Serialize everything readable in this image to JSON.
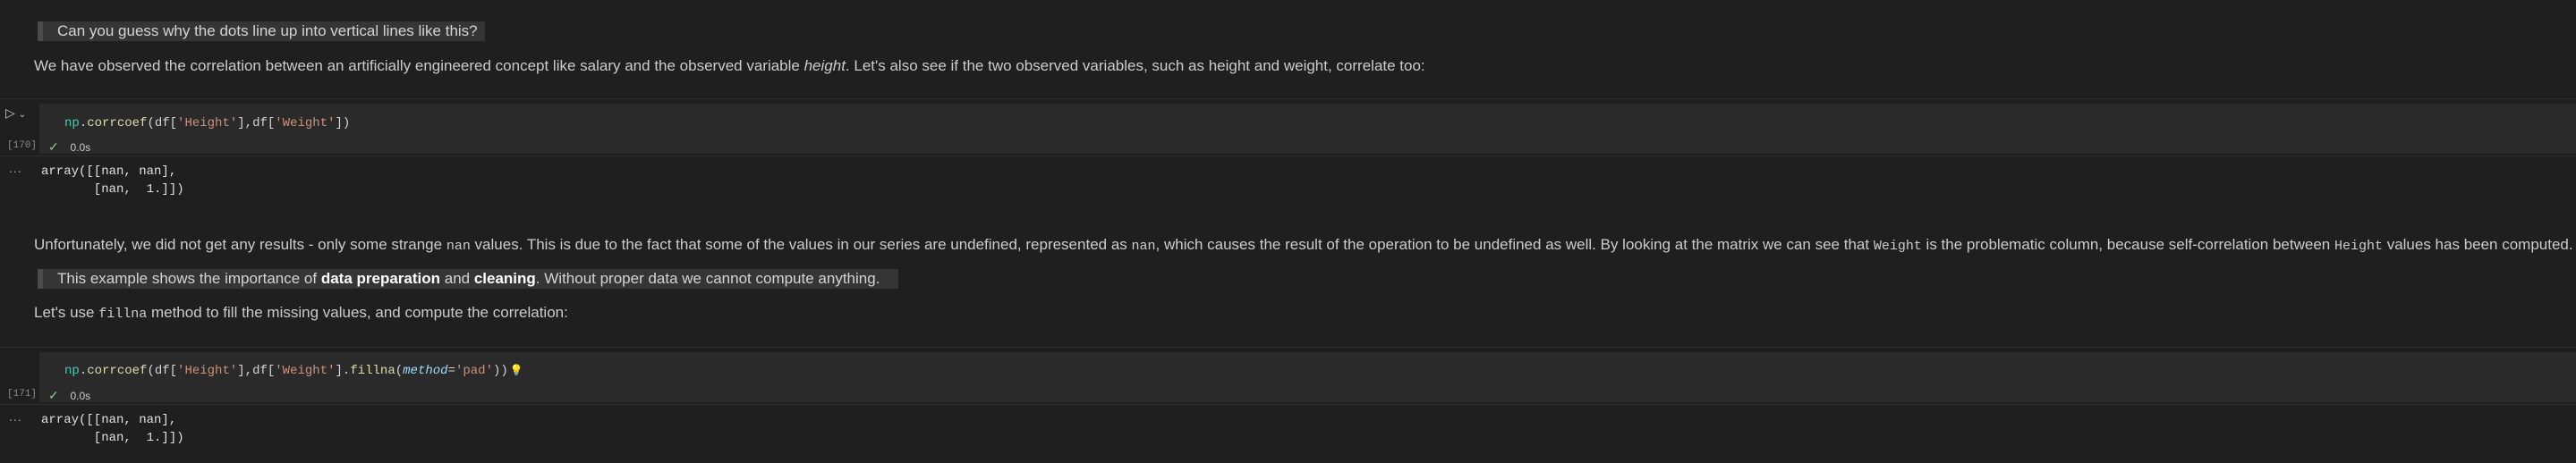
{
  "callout1": "Can you guess why the dots line up into vertical lines like this?",
  "para1": {
    "text_a": "We have observed the correlation between an artificially engineered concept like salary and the observed variable ",
    "em": "height",
    "text_b": ". Let's also see if the two observed variables, such as height and weight, correlate too:"
  },
  "cell1": {
    "prompt": "[170]",
    "code": {
      "np": "np",
      "dot": ".",
      "fn": "corrcoef",
      "open": "(df[",
      "s1": "'Height'",
      "mid": "],df[",
      "s2": "'Weight'",
      "close": "])"
    },
    "status_time": "0.0s",
    "output_dots": "...",
    "output": "array([[nan, nan],\n       [nan,  1.]])"
  },
  "para2": {
    "t1": "Unfortunately, we did not get any results - only some strange ",
    "c1": "nan",
    "t2": " values. This is due to the fact that some of the values in our series are undefined, represented as ",
    "c2": "nan",
    "t3": ", which causes the result of the operation to be undefined as well. By looking at the matrix we can see that ",
    "c3": "Weight",
    "t4": " is the problematic column, because self-correlation between ",
    "c4": "Height",
    "t5": " values has been computed."
  },
  "callout2": {
    "t1": "This example shows the importance of ",
    "b1": "data preparation",
    "t2": " and ",
    "b2": "cleaning",
    "t3": ". Without proper data we cannot compute anything."
  },
  "para3": {
    "t1": "Let's use ",
    "c1": "fillna",
    "t2": " method to fill the missing values, and compute the correlation:"
  },
  "cell2": {
    "prompt": "[171]",
    "code": {
      "np": "np",
      "dot": ".",
      "fn": "corrcoef",
      "open": "(df[",
      "s1": "'Height'",
      "mid": "],df[",
      "s2": "'Weight'",
      "dot2": "].",
      "fn2": "fillna",
      "paren": "(",
      "kw": "method",
      "eq": "=",
      "s3": "'pad'",
      "close": "))"
    },
    "lightbulb": "💡",
    "status_time": "0.0s",
    "output_dots": "...",
    "output": "array([[nan, nan],\n       [nan,  1.]])"
  },
  "icons": {
    "run": "play-icon",
    "chevron": "chevron-down-icon",
    "check": "check-icon",
    "bulb": "lightbulb-icon"
  }
}
